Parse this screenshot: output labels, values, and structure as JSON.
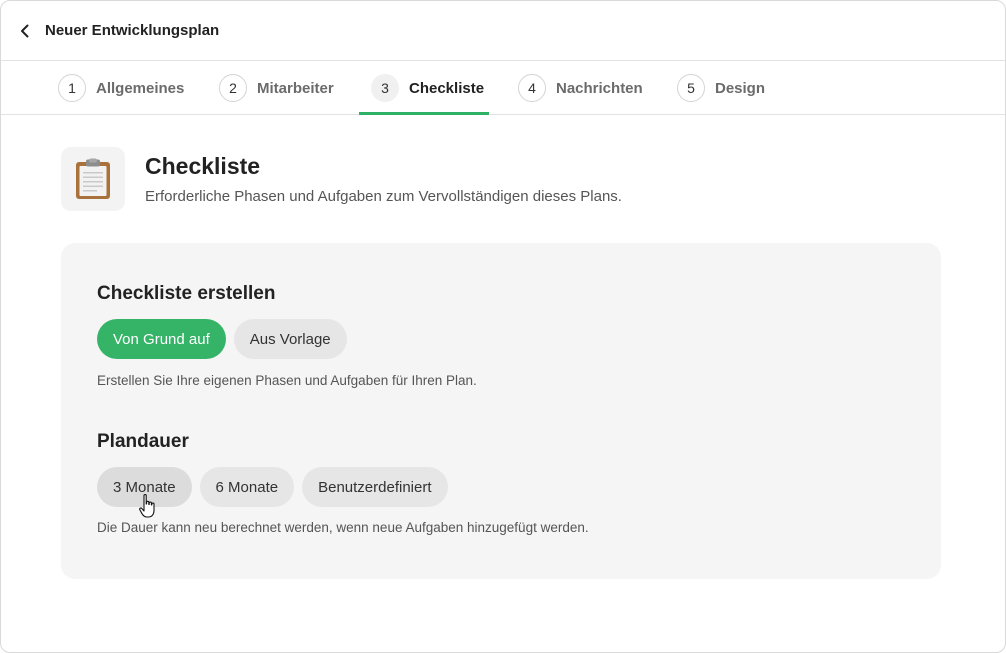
{
  "header": {
    "title": "Neuer Entwicklungsplan",
    "back_icon": "chevron-left-icon"
  },
  "tabs": [
    {
      "number": "1",
      "label": "Allgemeines",
      "active": false
    },
    {
      "number": "2",
      "label": "Mitarbeiter",
      "active": false
    },
    {
      "number": "3",
      "label": "Checkliste",
      "active": true
    },
    {
      "number": "4",
      "label": "Nachrichten",
      "active": false
    },
    {
      "number": "5",
      "label": "Design",
      "active": false
    }
  ],
  "page": {
    "icon": "clipboard-icon",
    "title": "Checkliste",
    "subtitle": "Erforderliche Phasen und Aufgaben zum Vervollständigen dieses Plans."
  },
  "create": {
    "title": "Checkliste erstellen",
    "options": [
      "Von Grund auf",
      "Aus Vorlage"
    ],
    "selected": "Von Grund auf",
    "hint": "Erstellen Sie Ihre eigenen Phasen und Aufgaben für Ihren Plan."
  },
  "duration": {
    "title": "Plandauer",
    "options": [
      "3 Monate",
      "6 Monate",
      "Benutzerdefiniert"
    ],
    "hovered": "3 Monate",
    "hint": "Die Dauer kann neu berechnet werden, wenn neue Aufgaben hinzugefügt werden."
  },
  "colors": {
    "accent": "#2eb165",
    "pill_selected": "#35b468",
    "pill": "#e6e6e6",
    "card": "#f5f5f5"
  }
}
